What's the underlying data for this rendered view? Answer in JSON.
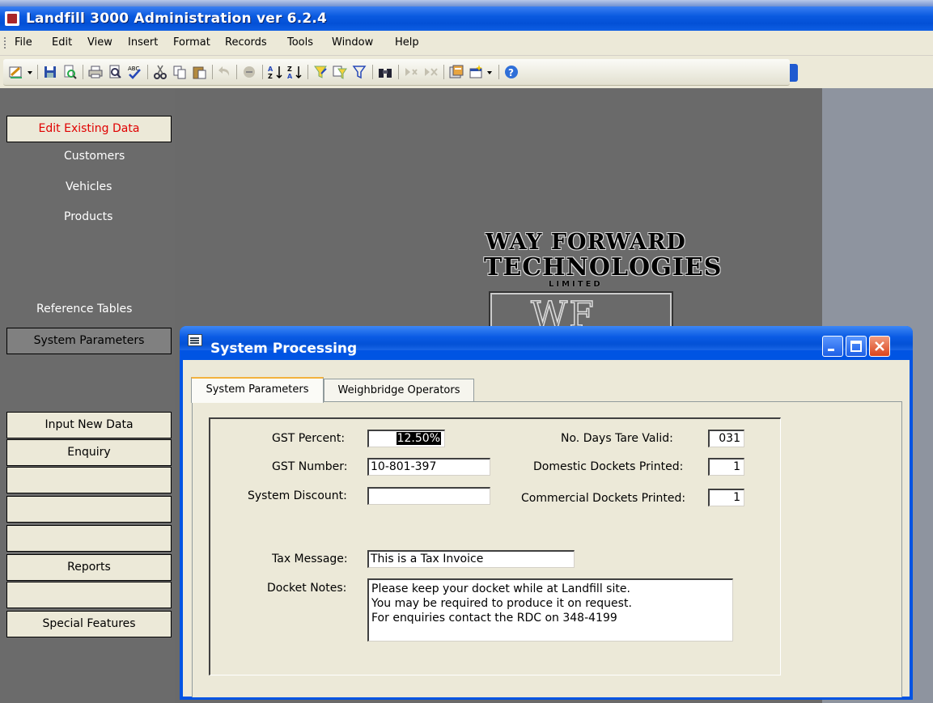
{
  "app": {
    "title": "Landfill 3000 Administration ver 6.2.4",
    "menu": [
      "File",
      "Edit",
      "View",
      "Insert",
      "Format",
      "Records",
      "Tools",
      "Window",
      "Help"
    ]
  },
  "toolbar": {
    "icons": [
      "design-view-icon",
      "save-icon",
      "file-search-icon",
      "print-icon",
      "print-preview-icon",
      "spelling-icon",
      "cut-icon",
      "copy-icon",
      "paste-icon",
      "undo-icon",
      "hyperlink-icon",
      "sort-ascending-icon",
      "sort-descending-icon",
      "filter-by-selection-icon",
      "filter-by-form-icon",
      "apply-filter-icon",
      "find-icon",
      "new-record-icon",
      "delete-record-icon",
      "database-window-icon",
      "new-object-icon",
      "help-icon"
    ]
  },
  "switchboard": {
    "edit_existing": "Edit Existing Data",
    "customers": "Customers",
    "vehicles": "Vehicles",
    "products": "Products",
    "reference_tables": "Reference Tables",
    "system_parameters": "System Parameters",
    "input_new_data": "Input New Data",
    "enquiry": "Enquiry",
    "reports": "Reports",
    "special_features": "Special Features"
  },
  "logo": {
    "line1": "WAY FORWARD",
    "line2": "TECHNOLOGIES",
    "line3": "LIMITED",
    "mark": "WF"
  },
  "dialog": {
    "title": "System Processing",
    "tabs": [
      "System Parameters",
      "Weighbridge Operators"
    ],
    "active_tab": 0,
    "fields": {
      "gst_percent": {
        "label": "GST Percent:",
        "value": "12.50%"
      },
      "gst_number": {
        "label": "GST Number:",
        "value": "10-801-397"
      },
      "system_discount": {
        "label": "System Discount:",
        "value": ""
      },
      "days_tare_valid": {
        "label": "No. Days Tare Valid:",
        "value": "031"
      },
      "domestic_dockets": {
        "label": "Domestic Dockets Printed:",
        "value": "1"
      },
      "commercial_dockets": {
        "label": "Commercial Dockets Printed:",
        "value": "1"
      },
      "tax_message": {
        "label": "Tax Message:",
        "value": "This is a Tax Invoice"
      },
      "docket_notes": {
        "label": "Docket Notes:",
        "lines": [
          "Please keep your docket while at Landfill site.",
          "You may be required to produce it on request.",
          "For enquiries contact the RDC on 348-4199"
        ]
      }
    }
  },
  "colors": {
    "xp_blue": "#0054e3",
    "dialog_face": "#ece9d8",
    "switchboard_bg": "#6b6b6b",
    "edit_label": "#e00000"
  }
}
